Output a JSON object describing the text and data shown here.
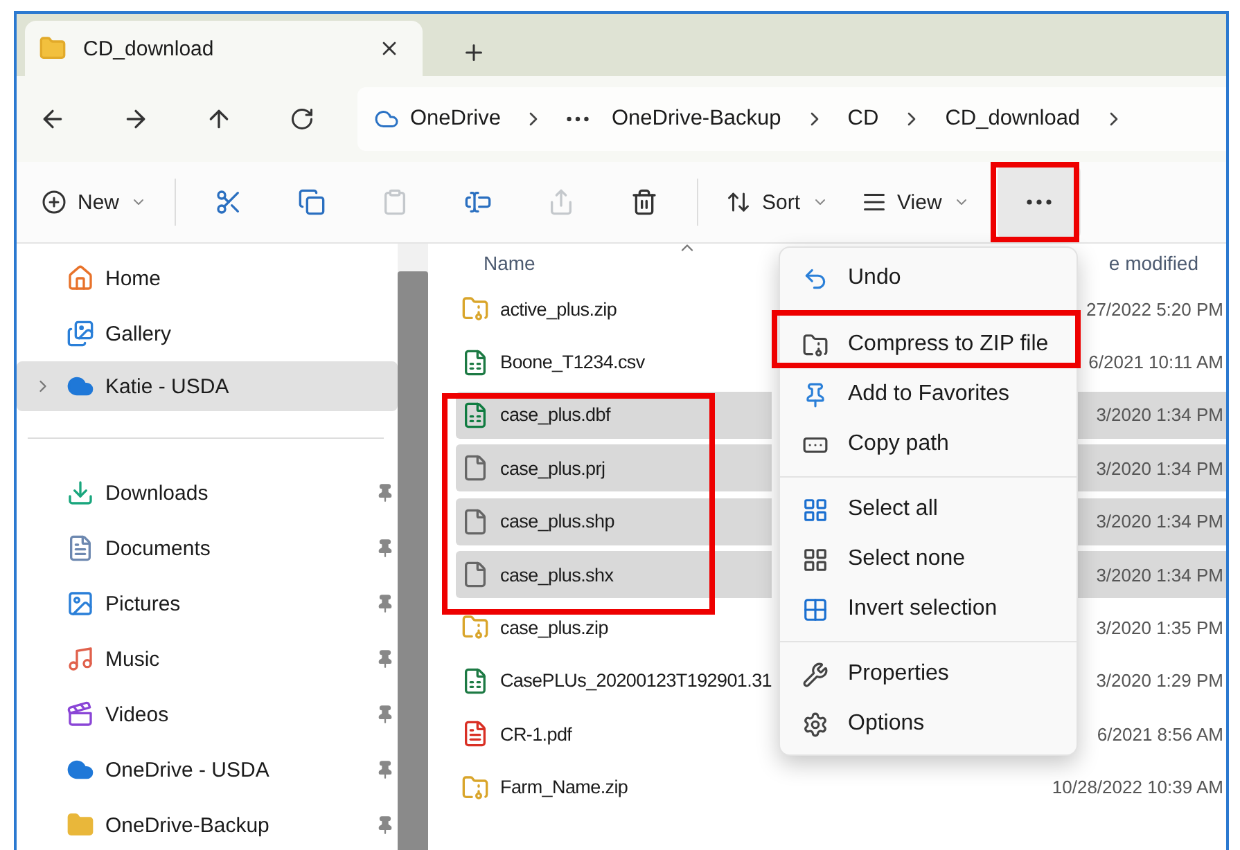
{
  "tab": {
    "title": "CD_download"
  },
  "address": {
    "crumbs": [
      {
        "kind": "root",
        "label": "OneDrive"
      },
      {
        "kind": "overflow"
      },
      {
        "kind": "folder",
        "label": "OneDrive-Backup"
      },
      {
        "kind": "folder",
        "label": "CD"
      },
      {
        "kind": "folder",
        "label": "CD_download"
      }
    ]
  },
  "toolbar": [
    {
      "kind": "new",
      "label": "New",
      "disabled": false,
      "pressed": false
    },
    {
      "kind": "separator"
    },
    {
      "kind": "cut",
      "disabled": false,
      "pressed": false
    },
    {
      "kind": "copy",
      "disabled": false,
      "pressed": false
    },
    {
      "kind": "paste",
      "disabled": true,
      "pressed": false
    },
    {
      "kind": "rename",
      "disabled": false,
      "pressed": false
    },
    {
      "kind": "share",
      "disabled": true,
      "pressed": false
    },
    {
      "kind": "delete",
      "disabled": false,
      "pressed": false
    },
    {
      "kind": "separator"
    },
    {
      "kind": "sort",
      "label": "Sort",
      "disabled": false,
      "pressed": false
    },
    {
      "kind": "view",
      "label": "View",
      "disabled": false,
      "pressed": false
    },
    {
      "kind": "more",
      "disabled": false,
      "pressed": true
    }
  ],
  "sidebar": {
    "top": [
      {
        "kind": "home",
        "label": "Home",
        "selected": false,
        "expandable": false
      },
      {
        "kind": "gallery",
        "label": "Gallery",
        "selected": false,
        "expandable": false
      },
      {
        "kind": "cloud",
        "label": "Katie - USDA",
        "selected": true,
        "expandable": true
      }
    ],
    "pinned": [
      {
        "kind": "downloads",
        "label": "Downloads",
        "pinned": true
      },
      {
        "kind": "documents",
        "label": "Documents",
        "pinned": true
      },
      {
        "kind": "pictures",
        "label": "Pictures",
        "pinned": true
      },
      {
        "kind": "music",
        "label": "Music",
        "pinned": true
      },
      {
        "kind": "videos",
        "label": "Videos",
        "pinned": true
      },
      {
        "kind": "cloud",
        "label": "OneDrive - USDA",
        "pinned": true
      },
      {
        "kind": "folder",
        "label": "OneDrive-Backup",
        "pinned": true
      }
    ]
  },
  "files": {
    "columns": [
      "Name",
      "e modified"
    ],
    "rows": [
      {
        "kind": "zip",
        "name": "active_plus.zip",
        "modified": "27/2022 5:20 PM",
        "selected": false
      },
      {
        "kind": "csv",
        "name": "Boone_T1234.csv",
        "modified": "6/2021 10:11 AM",
        "selected": false
      },
      {
        "kind": "excel",
        "name": "case_plus.dbf",
        "modified": "3/2020 1:34 PM",
        "selected": true
      },
      {
        "kind": "blank",
        "name": "case_plus.prj",
        "modified": "3/2020 1:34 PM",
        "selected": true
      },
      {
        "kind": "blank",
        "name": "case_plus.shp",
        "modified": "3/2020 1:34 PM",
        "selected": true
      },
      {
        "kind": "blank",
        "name": "case_plus.shx",
        "modified": "3/2020 1:34 PM",
        "selected": true
      },
      {
        "kind": "zip",
        "name": "case_plus.zip",
        "modified": "3/2020 1:35 PM",
        "selected": false
      },
      {
        "kind": "csv",
        "name": "CasePLUs_20200123T192901.31",
        "modified": "3/2020 1:29 PM",
        "selected": false
      },
      {
        "kind": "pdf",
        "name": "CR-1.pdf",
        "modified": "6/2021 8:56 AM",
        "selected": false
      },
      {
        "kind": "zip",
        "name": "Farm_Name.zip",
        "modified": "10/28/2022 10:39 AM",
        "selected": false
      }
    ]
  },
  "menu": [
    {
      "kind": "undo",
      "label": "Undo"
    },
    {
      "kind": "separator"
    },
    {
      "kind": "compress",
      "label": "Compress to ZIP file"
    },
    {
      "kind": "favorite",
      "label": "Add to Favorites"
    },
    {
      "kind": "copy-path",
      "label": "Copy path"
    },
    {
      "kind": "separator"
    },
    {
      "kind": "select-all",
      "label": "Select all"
    },
    {
      "kind": "select-none",
      "label": "Select none"
    },
    {
      "kind": "invert",
      "label": "Invert selection"
    },
    {
      "kind": "separator"
    },
    {
      "kind": "properties",
      "label": "Properties"
    },
    {
      "kind": "options",
      "label": "Options"
    }
  ]
}
